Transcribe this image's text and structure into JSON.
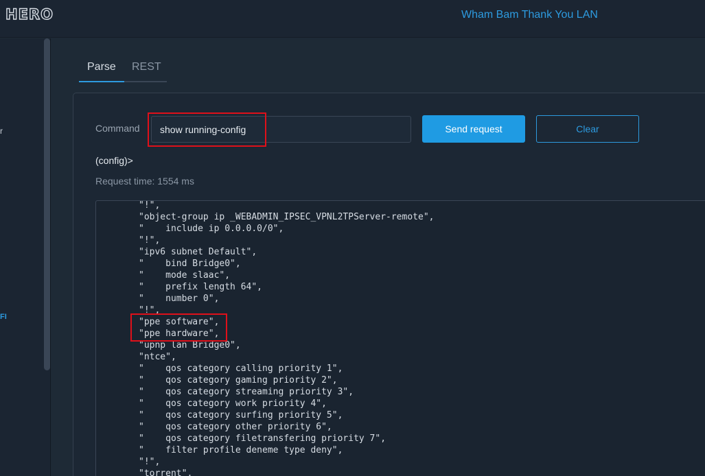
{
  "header": {
    "logo": "HERO",
    "network_name": "Wham Bam Thank You LAN"
  },
  "sidebar": {
    "partial_item_1": "r",
    "partial_item_2": "FI"
  },
  "tabs": [
    {
      "label": "Parse",
      "active": true
    },
    {
      "label": "REST",
      "active": false
    }
  ],
  "command": {
    "label": "Command",
    "value": "show running-config",
    "send_label": "Send request",
    "clear_label": "Clear"
  },
  "response": {
    "prompt": "(config)>",
    "request_time": "Request time: 1554 ms",
    "lines": [
      "\"!\",",
      "\"object-group ip _WEBADMIN_IPSEC_VPNL2TPServer-remote\",",
      "\"    include ip 0.0.0.0/0\",",
      "\"!\",",
      "\"ipv6 subnet Default\",",
      "\"    bind Bridge0\",",
      "\"    mode slaac\",",
      "\"    prefix length 64\",",
      "\"    number 0\",",
      "\"!\",",
      "\"ppe software\",",
      "\"ppe hardware\",",
      "\"upnp lan Bridge0\",",
      "\"ntce\",",
      "\"    qos category calling priority 1\",",
      "\"    qos category gaming priority 2\",",
      "\"    qos category streaming priority 3\",",
      "\"    qos category work priority 4\",",
      "\"    qos category surfing priority 5\",",
      "\"    qos category other priority 6\",",
      "\"    qos category filetransfering priority 7\",",
      "\"    filter profile deneme type deny\",",
      "\"!\",",
      "\"torrent\","
    ]
  },
  "colors": {
    "accent": "#1f9be3",
    "highlight": "#e0101a",
    "background": "#1e2a36"
  }
}
